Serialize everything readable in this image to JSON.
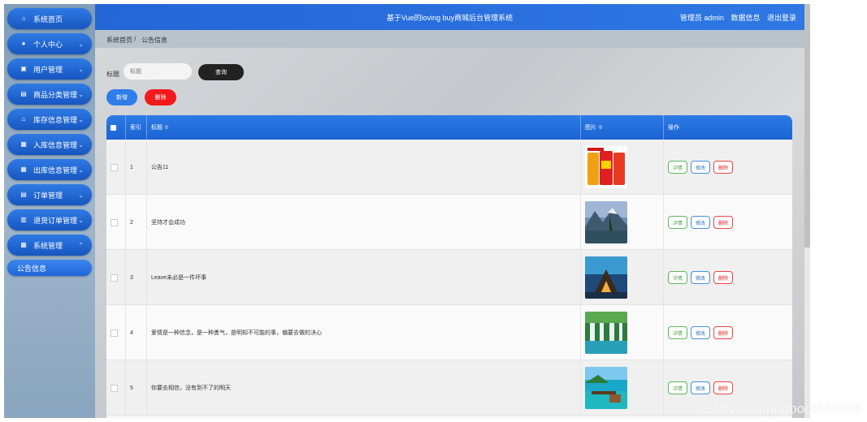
{
  "header": {
    "title": "基于Vue的loving buy商城后台管理系统",
    "user_label": "管理员 admin",
    "nav_data": "数据信息",
    "logout": "退出登录"
  },
  "breadcrumb": {
    "home": "系统首页",
    "separator": "/",
    "current": "公告信息"
  },
  "sidebar": {
    "items": [
      {
        "label": "系统首页",
        "icon": "home-icon",
        "chevron": ""
      },
      {
        "label": "个人中心",
        "icon": "user-icon",
        "chevron": "⌄"
      },
      {
        "label": "用户管理",
        "icon": "lock-icon",
        "chevron": "⌄"
      },
      {
        "label": "商品分类管理",
        "icon": "list-icon",
        "chevron": "⌄"
      },
      {
        "label": "库存信息管理",
        "icon": "store-icon",
        "chevron": "⌄"
      },
      {
        "label": "入库信息管理",
        "icon": "grid-icon",
        "chevron": "⌄"
      },
      {
        "label": "出库信息管理",
        "icon": "grid-icon",
        "chevron": "⌄"
      },
      {
        "label": "订单管理",
        "icon": "list-icon",
        "chevron": "⌄"
      },
      {
        "label": "退货订单管理",
        "icon": "doc-icon",
        "chevron": "⌄"
      },
      {
        "label": "系统管理",
        "icon": "grid-icon",
        "chevron": "⌃"
      }
    ],
    "sub_item": "公告信息"
  },
  "search": {
    "label": "标题",
    "placeholder": "标题",
    "button": "查询"
  },
  "actions": {
    "add": "新增",
    "delete": "删除"
  },
  "table": {
    "columns": [
      "索引",
      "标题 ≑",
      "图片 ≑",
      "操作"
    ],
    "rows": [
      {
        "index": "1",
        "title": "公告11"
      },
      {
        "index": "2",
        "title": "坚持才会成功"
      },
      {
        "index": "3",
        "title": "Leave未必是一件坏事"
      },
      {
        "index": "4",
        "title": "爱情是一种信念，是一种勇气，是明知不可能的事，偏要去做的决心"
      },
      {
        "index": "5",
        "title": "你要去相信，没有到不了的明天"
      }
    ],
    "op_labels": {
      "detail": "详情",
      "edit": "修改",
      "remove": "删除"
    }
  },
  "watermark": "CSDN @springboot666666"
}
